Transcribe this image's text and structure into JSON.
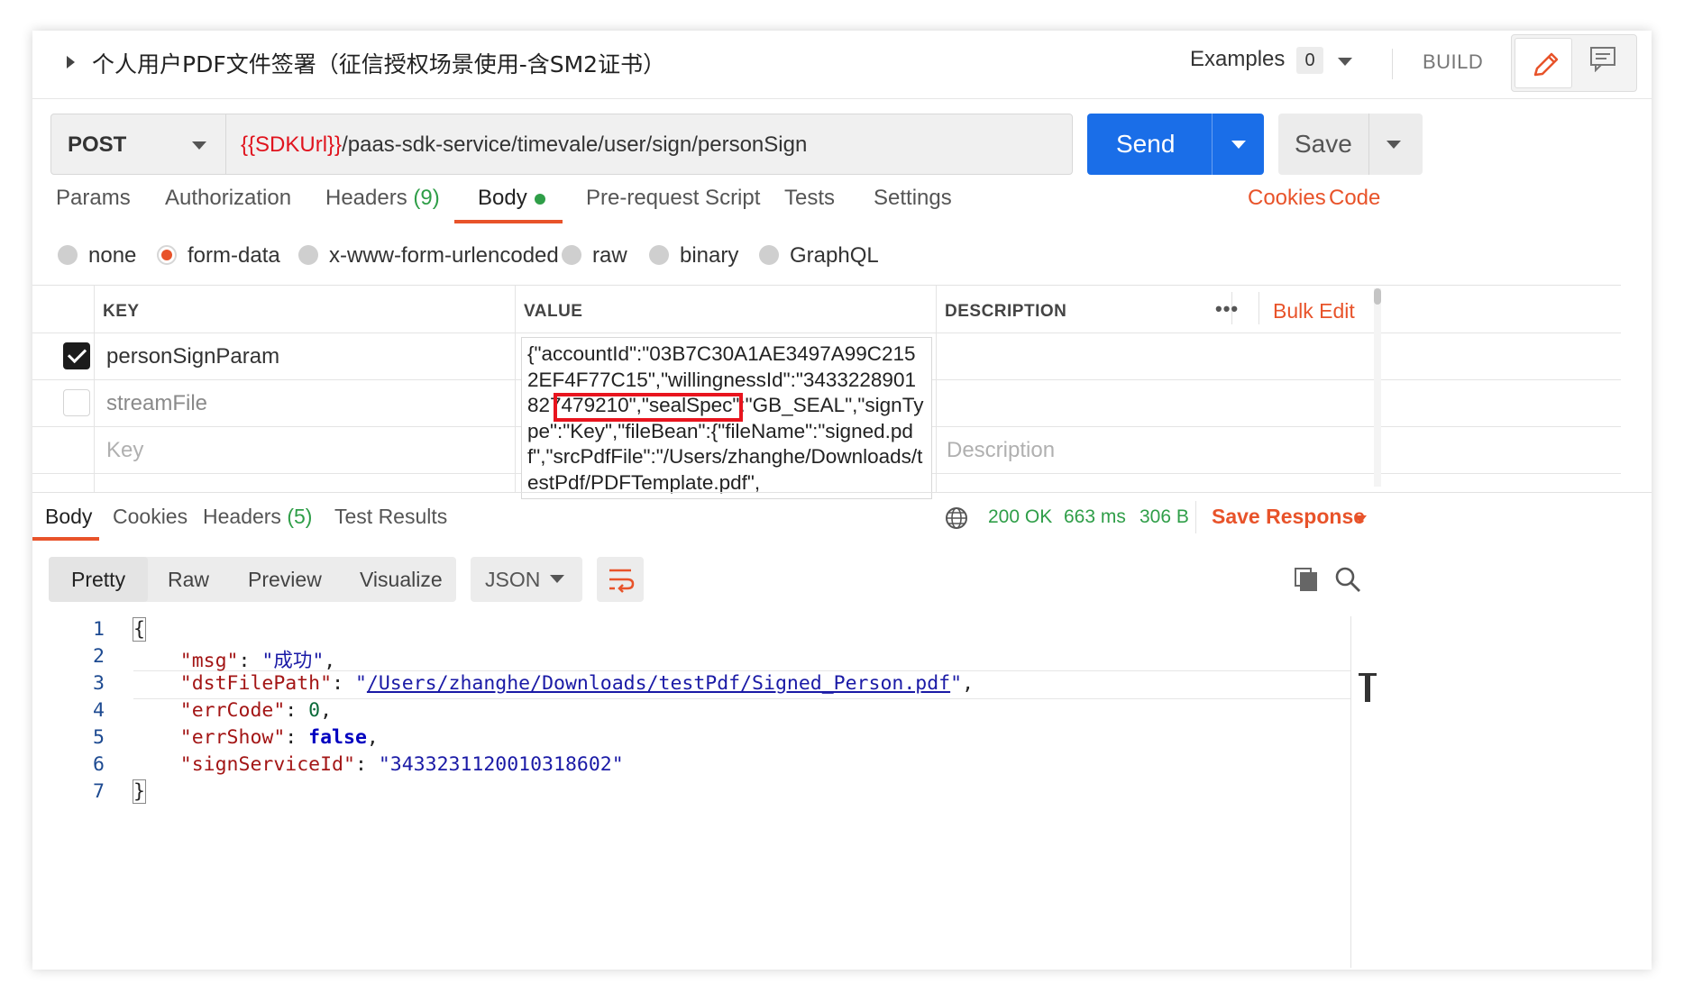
{
  "header": {
    "title": "个人用户PDF文件签署（征信授权场景使用-含SM2证书）",
    "examples_label": "Examples",
    "examples_count": "0",
    "build_label": "BUILD"
  },
  "request": {
    "method": "POST",
    "url_variable": "{{SDKUrl}}",
    "url_path": "/paas-sdk-service/timevale/user/sign/personSign",
    "send_label": "Send",
    "save_label": "Save"
  },
  "request_tabs": {
    "params": "Params",
    "authorization": "Authorization",
    "headers": "Headers",
    "headers_count": "(9)",
    "body": "Body",
    "prerequest": "Pre-request Script",
    "tests": "Tests",
    "settings": "Settings",
    "cookies": "Cookies",
    "code": "Code"
  },
  "body_types": {
    "none": "none",
    "form_data": "form-data",
    "urlencoded": "x-www-form-urlencoded",
    "raw": "raw",
    "binary": "binary",
    "graphql": "GraphQL",
    "selected": "form-data"
  },
  "table": {
    "headers": {
      "key": "KEY",
      "value": "VALUE",
      "description": "DESCRIPTION"
    },
    "more": "•••",
    "bulk_edit": "Bulk Edit",
    "rows": [
      {
        "key": "personSignParam",
        "checked": true
      },
      {
        "key": "streamFile",
        "checked": false
      }
    ],
    "key_placeholder": "Key",
    "description_placeholder": "Description",
    "value_text": "{\"accountId\":\"03B7C30A1AE3497A99C2152EF4F77C15\",\"willingnessId\":\"3433228901827479210\",\"sealSpec\":\"GB_SEAL\",\"signType\":\"Key\",\"fileBean\":{\"fileName\":\"signed.pdf\",\"srcPdfFile\":\"/Users/zhanghe/Downloads/testPdf/PDFTemplate.pdf\","
  },
  "response_tabs": {
    "body": "Body",
    "cookies": "Cookies",
    "headers": "Headers",
    "headers_count": "(5)",
    "test_results": "Test Results"
  },
  "response_status": {
    "status": "200 OK",
    "time": "663 ms",
    "size": "306 B",
    "save_response": "Save Response"
  },
  "format": {
    "pretty": "Pretty",
    "raw": "Raw",
    "preview": "Preview",
    "visualize": "Visualize",
    "language": "JSON"
  },
  "code_lines": [
    "1",
    "2",
    "3",
    "4",
    "5",
    "6",
    "7"
  ],
  "response_json": {
    "open": "{",
    "msg_key": "\"msg\"",
    "msg_val": "\"成功\"",
    "dst_key": "\"dstFilePath\"",
    "dst_val": "/Users/zhanghe/Downloads/testPdf/Signed_Person.pdf",
    "err_key": "\"errCode\"",
    "err_val": "0",
    "show_key": "\"errShow\"",
    "show_val": "false",
    "sid_key": "\"signServiceId\"",
    "sid_val": "\"3433231120010318602\"",
    "close": "}"
  },
  "colors": {
    "accent": "#e8532a",
    "send_blue": "#1a6ee8",
    "status_green": "#2f9e48",
    "highlight_red": "#e8141e"
  }
}
